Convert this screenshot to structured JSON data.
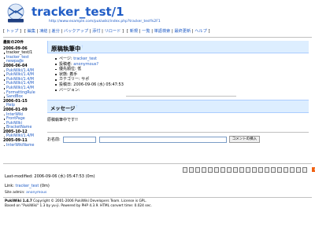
{
  "header": {
    "logo_text": "PUKIWIKI",
    "title": "tracker_test/1",
    "url": "http://www.example.com/pukiwiki/index.php?tracker_test%2F1"
  },
  "nav": [
    [
      "トップ"
    ],
    [
      "編集",
      "凍結",
      "差分",
      "バックアップ",
      "添付",
      "リロード"
    ],
    [
      "新規",
      "一覧",
      "単語検索",
      "最終更新",
      "ヘルプ"
    ]
  ],
  "menu": {
    "title": "最新の20件",
    "groups": [
      {
        "date": "2006-09-06",
        "items": [
          "tracker_test/1",
          "tracker_test",
          "newpage"
        ]
      },
      {
        "date": "2006-06-04",
        "items": [
          "PukiWiki/1.4/M",
          "PukiWiki/1.4/M",
          "PukiWiki/1.4/M",
          "PukiWiki/1.4/M",
          "PukiWiki/1.4/M",
          "FormattingRule",
          "SandBox"
        ]
      },
      {
        "date": "2006-01-15",
        "items": [
          "Help"
        ]
      },
      {
        "date": "2006-01-09",
        "items": [
          "InterWiki",
          "FrontPage",
          "PukiWiki",
          "BracketName"
        ]
      },
      {
        "date": "2005-10-12",
        "items": [
          "PukiWiki/1.4/M"
        ]
      },
      {
        "date": "2005-09-11",
        "items": [
          "InterWikiName"
        ]
      }
    ]
  },
  "main": {
    "heading": "原稿執筆中",
    "anchor": "†",
    "info": [
      {
        "label": "ページ: ",
        "value": "tracker_test",
        "link": true
      },
      {
        "label": "投稿者: ",
        "value": "anonymous?",
        "link": true
      },
      {
        "label": "優先順位: ",
        "value": "低",
        "link": false
      },
      {
        "label": "状態: ",
        "value": "着手",
        "link": false
      },
      {
        "label": "カテゴリー: ",
        "value": "サポ",
        "link": false
      },
      {
        "label": "投稿日: ",
        "value": "2006-09-06 (水) 05:47:53",
        "link": false
      },
      {
        "label": "バージョン: ",
        "value": "",
        "link": false
      }
    ],
    "section2": "メッセージ",
    "message": "原稿執筆中です!!",
    "comment": {
      "name_label": "お名前:",
      "button": "コメントの挿入"
    }
  },
  "footer": {
    "toolbar_count": 20,
    "rss_label": "RSS",
    "last_modified": "Last-modified: 2006-09-06 (水) 05:47:53 (0m)",
    "link_label": "Link: ",
    "link_value": "tracker_test",
    "link_suffix": "(0m)",
    "admin_label": "Site admin: ",
    "admin_value": "anonymous",
    "credit1_bold": "PukiWiki 1.4.7",
    "credit1_rest": " Copyright © 2001-2006 PukiWiki Developers Team. License is GPL.",
    "credit2": "Based on \"PukiWiki\" 1.3 by yu-ji. Powered by PHP 4.3.9. HTML convert time: 0.024 sec."
  },
  "colors": {
    "link": "#215dc6",
    "visited": "#a63d21",
    "heading_bg": "#ddeeff",
    "rss": "#f06010"
  }
}
